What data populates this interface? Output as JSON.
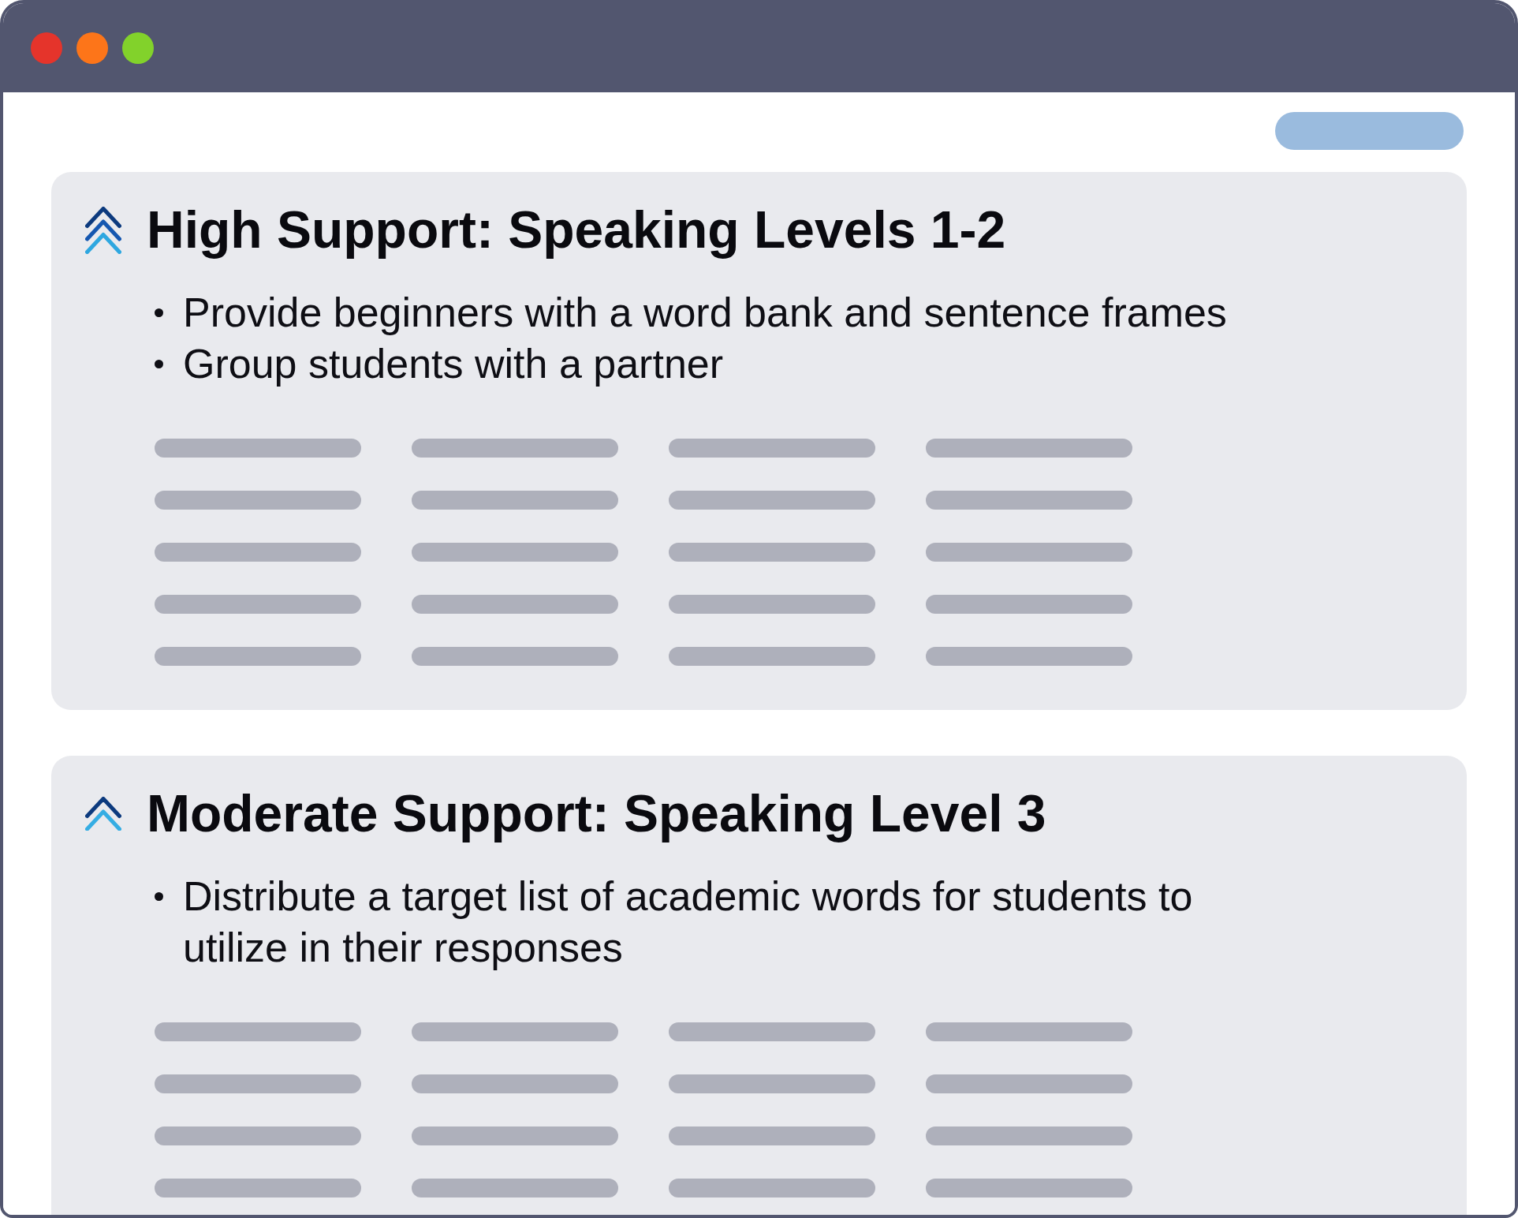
{
  "window": {
    "controls": [
      {
        "color": "#e5342b"
      },
      {
        "color": "#fd7519"
      },
      {
        "color": "#82d22b"
      }
    ]
  },
  "sections": [
    {
      "kind": "high",
      "title": "High Support: Speaking Levels 1-2",
      "bullets": [
        "Provide beginners with a word bank and sentence frames",
        "Group students with a partner"
      ]
    },
    {
      "kind": "moderate",
      "title": "Moderate Support: Speaking Level 3",
      "bullets": [
        "Distribute a target list of academic words for students to utilize in their responses"
      ]
    }
  ]
}
